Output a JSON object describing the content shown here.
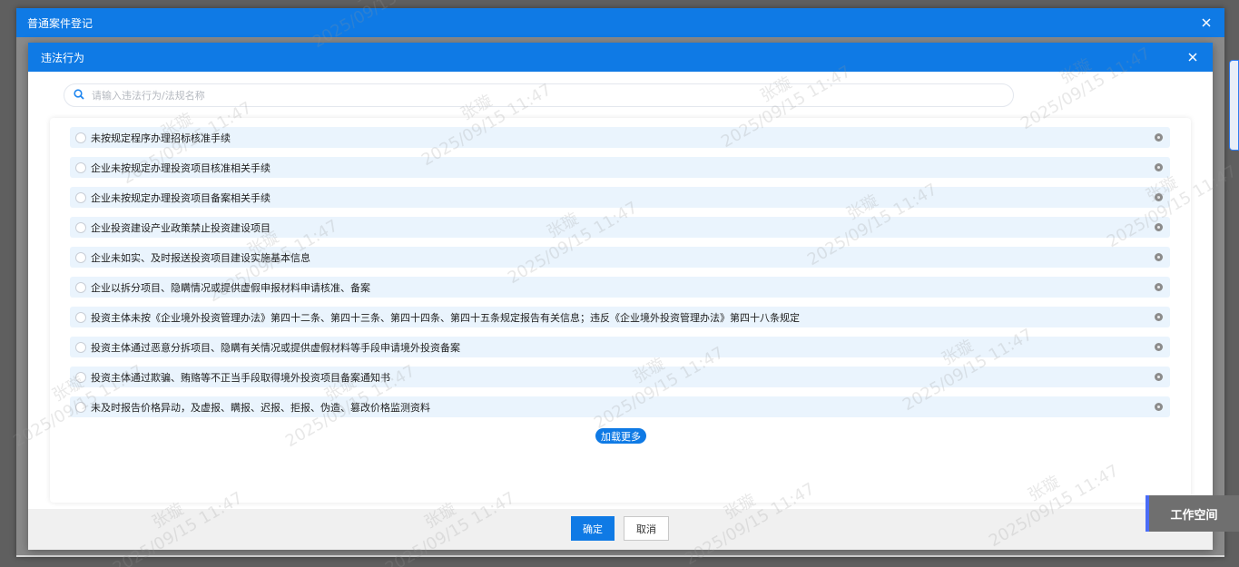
{
  "outer_dialog": {
    "title": "普通案件登记"
  },
  "inner_dialog": {
    "title": "违法行为"
  },
  "search": {
    "placeholder": "请输入违法行为/法规名称"
  },
  "items": [
    {
      "label": "未按规定程序办理招标核准手续"
    },
    {
      "label": "企业未按规定办理投资项目核准相关手续"
    },
    {
      "label": "企业未按规定办理投资项目备案相关手续"
    },
    {
      "label": "企业投资建设产业政策禁止投资建设项目"
    },
    {
      "label": "企业未如实、及时报送投资项目建设实施基本信息"
    },
    {
      "label": "企业以拆分项目、隐瞒情况或提供虚假申报材料申请核准、备案"
    },
    {
      "label": "投资主体未按《企业境外投资管理办法》第四十二条、第四十三条、第四十四条、第四十五条规定报告有关信息；违反《企业境外投资管理办法》第四十八条规定"
    },
    {
      "label": "投资主体通过恶意分拆项目、隐瞒有关情况或提供虚假材料等手段申请境外投资备案"
    },
    {
      "label": "投资主体通过欺骗、贿赂等不正当手段取得境外投资项目备案通知书"
    },
    {
      "label": "未及时报告价格异动，及虚报、瞒报、迟报、拒报、伪造、篡改价格监测资料"
    }
  ],
  "load_more_label": "加载更多",
  "footer": {
    "confirm_label": "确定",
    "cancel_label": "取消"
  },
  "workspace_label": "工作空间",
  "watermark": {
    "name": "张璇",
    "datetime": "2025/09/15 11:47"
  },
  "colors": {
    "primary": "#0f7ae5",
    "row_bg": "#eaf4fd",
    "overlay": "#5f5f5f"
  }
}
